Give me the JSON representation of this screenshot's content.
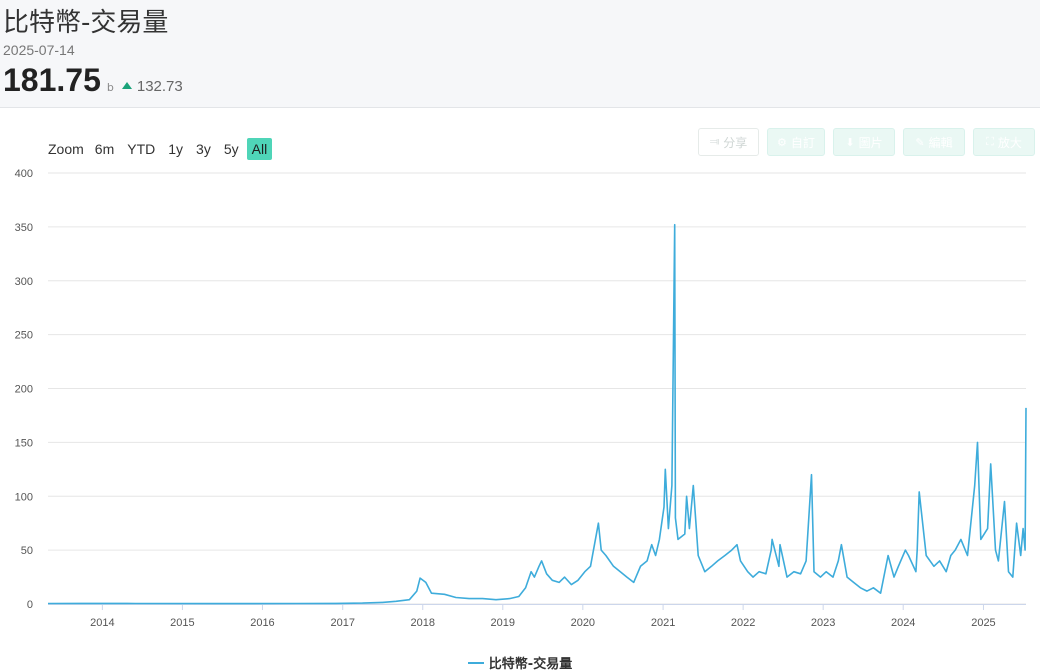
{
  "header": {
    "title": "比特幣-交易量",
    "date": "2025-07-14",
    "value": "181.75",
    "unit": "b",
    "change": "132.73"
  },
  "rangebar": {
    "zoom_label": "Zoom",
    "buttons": [
      "6m",
      "YTD",
      "1y",
      "3y",
      "5y",
      "All"
    ],
    "active": "All"
  },
  "toolbar": {
    "share_label": "分享",
    "custom_label": "自訂",
    "image_label": "圖片",
    "edit_label": "編輯",
    "fullscreen_label": "放大"
  },
  "colors": {
    "series": "#3eacdb",
    "accent": "#4fd5b8",
    "up": "#1aa37a"
  },
  "chart_data": {
    "type": "line",
    "series": [
      {
        "name": "比特幣-交易量",
        "x": [
          "2013-04-28",
          "2013-10-01",
          "2014-06-01",
          "2015-06-01",
          "2016-06-01",
          "2016-12-01",
          "2017-04-01",
          "2017-07-01",
          "2017-09-01",
          "2017-11-01",
          "2017-12-05",
          "2017-12-20",
          "2018-01-15",
          "2018-02-10",
          "2018-04-10",
          "2018-06-01",
          "2018-08-01",
          "2018-10-01",
          "2018-12-01",
          "2019-02-01",
          "2019-03-15",
          "2019-04-15",
          "2019-05-10",
          "2019-05-25",
          "2019-06-15",
          "2019-06-27",
          "2019-07-20",
          "2019-08-15",
          "2019-09-15",
          "2019-10-10",
          "2019-11-10",
          "2019-12-10",
          "2020-01-10",
          "2020-02-05",
          "2020-03-12",
          "2020-03-25",
          "2020-04-15",
          "2020-05-20",
          "2020-06-20",
          "2020-07-20",
          "2020-08-20",
          "2020-09-20",
          "2020-10-20",
          "2020-11-10",
          "2020-11-28",
          "2020-12-15",
          "2021-01-05",
          "2021-01-11",
          "2021-01-25",
          "2021-02-10",
          "2021-02-23",
          "2021-02-26",
          "2021-03-10",
          "2021-04-10",
          "2021-04-18",
          "2021-05-01",
          "2021-05-19",
          "2021-06-10",
          "2021-07-10",
          "2021-08-10",
          "2021-09-07",
          "2021-10-10",
          "2021-11-10",
          "2021-12-04",
          "2021-12-20",
          "2022-01-22",
          "2022-02-15",
          "2022-03-15",
          "2022-04-15",
          "2022-05-09",
          "2022-05-13",
          "2022-06-13",
          "2022-06-18",
          "2022-07-20",
          "2022-08-20",
          "2022-09-20",
          "2022-10-15",
          "2022-11-09",
          "2022-11-20",
          "2022-12-20",
          "2023-01-15",
          "2023-02-15",
          "2023-03-11",
          "2023-03-25",
          "2023-04-20",
          "2023-05-20",
          "2023-06-20",
          "2023-07-20",
          "2023-08-18",
          "2023-09-20",
          "2023-10-24",
          "2023-11-20",
          "2023-12-10",
          "2024-01-11",
          "2024-01-25",
          "2024-02-28",
          "2024-03-05",
          "2024-03-14",
          "2024-04-15",
          "2024-05-20",
          "2024-06-15",
          "2024-07-15",
          "2024-08-05",
          "2024-08-25",
          "2024-09-20",
          "2024-10-20",
          "2024-11-12",
          "2024-11-22",
          "2024-12-05",
          "2024-12-20",
          "2025-01-20",
          "2025-02-03",
          "2025-02-25",
          "2025-03-10",
          "2025-04-07",
          "2025-04-25",
          "2025-05-15",
          "2025-06-01",
          "2025-06-20",
          "2025-07-01",
          "2025-07-10",
          "2025-07-14"
        ],
        "values": [
          0.5,
          0.6,
          0.5,
          0.4,
          0.5,
          0.6,
          0.8,
          1.5,
          2.5,
          4,
          12,
          24,
          20,
          10,
          9,
          6,
          5,
          5,
          4,
          5,
          7,
          15,
          30,
          25,
          35,
          40,
          28,
          22,
          20,
          25,
          18,
          22,
          30,
          35,
          75,
          50,
          45,
          35,
          30,
          25,
          20,
          35,
          40,
          55,
          45,
          60,
          90,
          125,
          70,
          110,
          352,
          80,
          60,
          65,
          100,
          70,
          110,
          45,
          30,
          35,
          40,
          45,
          50,
          55,
          40,
          30,
          25,
          30,
          28,
          50,
          60,
          35,
          55,
          25,
          30,
          28,
          40,
          120,
          30,
          25,
          30,
          25,
          40,
          55,
          25,
          20,
          15,
          12,
          15,
          10,
          45,
          25,
          35,
          50,
          45,
          30,
          50,
          104,
          45,
          35,
          40,
          30,
          45,
          50,
          60,
          45,
          90,
          110,
          150,
          60,
          70,
          130,
          50,
          40,
          95,
          30,
          25,
          75,
          45,
          70,
          50,
          182
        ]
      }
    ],
    "xlabel": "",
    "ylabel": "",
    "ylim": [
      0,
      400
    ],
    "yticks": [
      0,
      50,
      100,
      150,
      200,
      250,
      300,
      350,
      400
    ],
    "xticks": [
      "2014",
      "2015",
      "2016",
      "2017",
      "2018",
      "2019",
      "2020",
      "2021",
      "2022",
      "2023",
      "2024",
      "2025"
    ],
    "xlim": [
      "2013-04-28",
      "2025-07-14"
    ],
    "grid": true,
    "legend": "bottom-center"
  }
}
